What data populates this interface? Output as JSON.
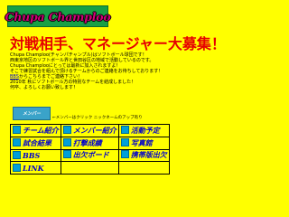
{
  "banner": {
    "title": "Chupa Champloo"
  },
  "headline": "対戦相手、マネージャー大募集！",
  "intro": {
    "line1": "Chupa Champloo(チャンパチャンプル)はソフトボール球団です！",
    "line2": "西東京地区のソフトボール界と世田谷区の地域で活動しているのです。",
    "line3": "Chupa Champlooにとっては最新に加入されますよ！",
    "line4": "そこで練習試合を組んで頂けるチームからのご連絡をお待ちしております！",
    "line5_link": "BBS",
    "line5_rest": "からこちらまでご連絡下さい！",
    "line6": "2010年 秋にソフトボール方の特別なチームを結成しました！",
    "line7": "何卒、よろしくお願い致します！"
  },
  "member_button": {
    "label": "メンバー"
  },
  "member_caption": "←メンバーはクリック ニックネームのアップ有り",
  "nav": {
    "rows": [
      [
        "チーム紹介",
        "メンバー紹介",
        "活動予定"
      ],
      [
        "試合結果",
        "打撃成績",
        "写真館"
      ],
      [
        "BBS",
        "出欠ボード",
        "携帯版出欠"
      ],
      [
        "LINK",
        "",
        ""
      ]
    ]
  },
  "colors": {
    "background": "#ffff00",
    "headline": "#e60000",
    "link": "#0000cc",
    "banner": "#17a045"
  }
}
